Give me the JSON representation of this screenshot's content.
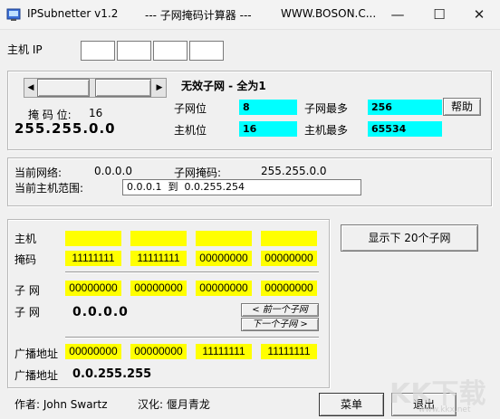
{
  "window": {
    "title": "IPSubnetter v1.2",
    "title_mid": "--- 子网掩码计算器 ---",
    "title_url": "WWW.BOSON.C..."
  },
  "host_ip": {
    "label": "主机 IP",
    "octets": [
      "",
      "",
      "",
      ""
    ]
  },
  "mask_panel": {
    "mask_bits_label": "掩 码 位:",
    "mask_bits_value": "16",
    "mask_value": "255.255.0.0",
    "invalid_msg": "无效子网 - 全为1",
    "subnet_bits_label": "子网位",
    "subnet_bits_value": "8",
    "max_subnets_label": "子网最多",
    "max_subnets_value": "256",
    "help_button": "帮助",
    "host_bits_label": "主机位",
    "host_bits_value": "16",
    "max_hosts_label": "主机最多",
    "max_hosts_value": "65534"
  },
  "current": {
    "network_label": "当前网络:",
    "network_value": "0.0.0.0",
    "subnet_mask_label": "子网掩码:",
    "subnet_mask_value": "255.255.0.0",
    "host_range_label": "当前主机范围:",
    "host_range_value": "0.0.0.1  到  0.0.255.254"
  },
  "binary": {
    "host_label": "主机",
    "host_bits": [
      "",
      "",
      "",
      ""
    ],
    "mask_label": "掩码",
    "mask_bits": [
      "11111111",
      "11111111",
      "00000000",
      "00000000"
    ],
    "subnet_label": "子 网",
    "subnet_bits": [
      "00000000",
      "00000000",
      "00000000",
      "00000000"
    ],
    "subnet_label2": "子 网",
    "subnet_value": "0.0.0.0",
    "prev_subnet_button": "< 前一个子网",
    "next_subnet_button": "下一个子网 >",
    "broadcast_label": "广播地址",
    "broadcast_bits": [
      "00000000",
      "00000000",
      "11111111",
      "11111111"
    ],
    "broadcast_label2": "广播地址",
    "broadcast_value": "0.0.255.255"
  },
  "show_subnets_button": "显示下 20个子网",
  "footer": {
    "author": "作者: John Swartz",
    "localized": "汉化: 偃月青龙",
    "menu_button": "菜单",
    "exit_button": "退出"
  },
  "watermark": "KK下载",
  "watermark_url": "www.kkx.net"
}
